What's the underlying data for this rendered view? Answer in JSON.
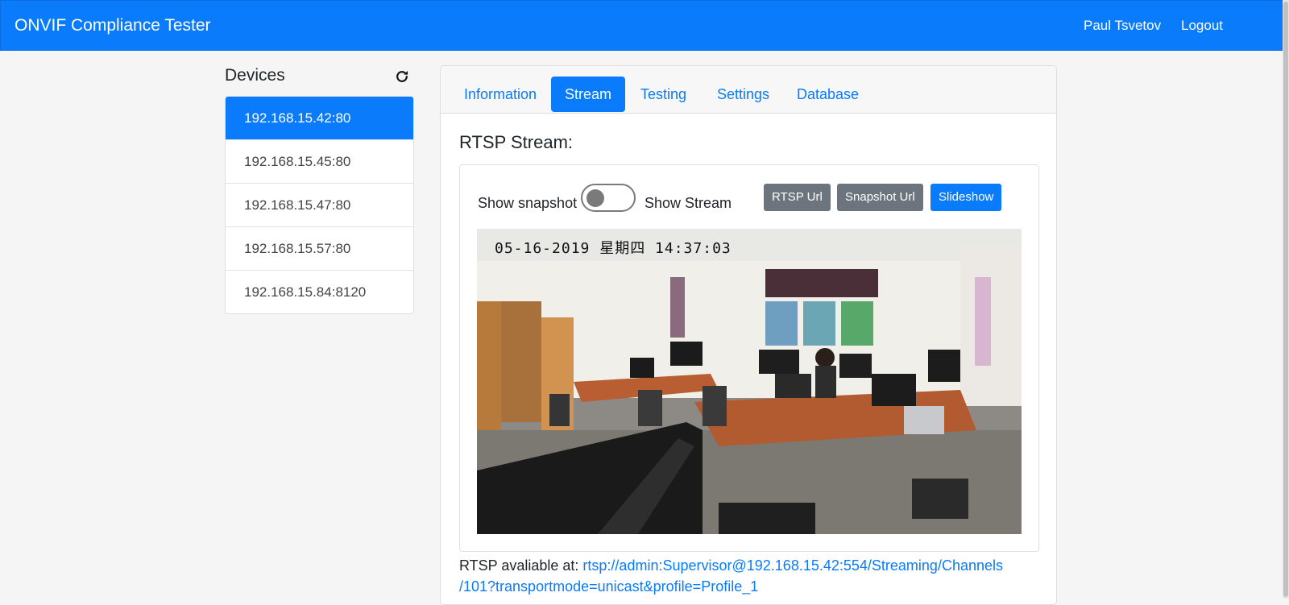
{
  "app": {
    "title": "ONVIF Compliance Tester",
    "user": "Paul Tsvetov",
    "logout": "Logout"
  },
  "devices": {
    "title": "Devices",
    "items": [
      {
        "label": "192.168.15.42:80",
        "active": true
      },
      {
        "label": "192.168.15.45:80",
        "active": false
      },
      {
        "label": "192.168.15.47:80",
        "active": false
      },
      {
        "label": "192.168.15.57:80",
        "active": false
      },
      {
        "label": "192.168.15.84:8120",
        "active": false
      }
    ]
  },
  "tabs": [
    {
      "label": "Information",
      "active": false
    },
    {
      "label": "Stream",
      "active": true
    },
    {
      "label": "Testing",
      "active": false
    },
    {
      "label": "Settings",
      "active": false
    },
    {
      "label": "Database",
      "active": false
    }
  ],
  "stream": {
    "title": "RTSP Stream:",
    "show_snapshot": "Show snapshot",
    "show_stream": "Show Stream",
    "toggle_on": false,
    "buttons": {
      "rtsp_url": "RTSP Url",
      "snapshot_url": "Snapshot Url",
      "slideshow": "Slideshow"
    },
    "video_timestamp": "05-16-2019 星期四 14:37:03",
    "rtsp_prefix": "RTSP avaliable at: ",
    "rtsp_url_line1": "rtsp://admin:Supervisor@192.168.15.42:554/Streaming/Channels",
    "rtsp_url_line2": "/101?transportmode=unicast&profile=Profile_1"
  },
  "colors": {
    "primary": "#0a7bfa",
    "secondary": "#6c757d"
  },
  "icons": {
    "refresh": "refresh-icon"
  }
}
